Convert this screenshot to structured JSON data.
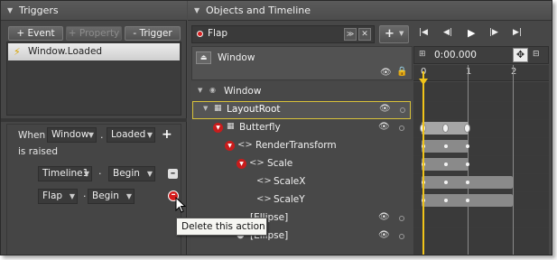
{
  "triggers": {
    "title": "Triggers",
    "buttons": {
      "event": "+ Event",
      "property": "+ Property",
      "trigger": "- Trigger"
    },
    "list_item": "Window.Loaded",
    "condition": {
      "when": "When",
      "target": "Window",
      "dot": ".",
      "event": "Loaded",
      "is_raised": "is raised"
    },
    "actions": [
      {
        "target": "Timeline1",
        "sep": "·",
        "verb": "Begin"
      },
      {
        "target": "Flap",
        "sep": "·",
        "verb": "Begin"
      }
    ],
    "tooltip": "Delete this action"
  },
  "objects": {
    "title": "Objects and Timeline",
    "storyboard_name": "Flap",
    "time_display": "0:00.000",
    "root_name": "Window",
    "tree": [
      {
        "label": "Window"
      },
      {
        "label": "LayoutRoot"
      },
      {
        "label": "Butterfly"
      },
      {
        "label": "RenderTransform"
      },
      {
        "label": "Scale"
      },
      {
        "label": "ScaleX"
      },
      {
        "label": "ScaleY"
      },
      {
        "label": "[Ellipse]"
      },
      {
        "label": "[Ellipse]"
      }
    ],
    "ruler": [
      "0",
      "1",
      "2"
    ],
    "colors": {
      "playhead": "#f0c419",
      "selection": "#d8c23a",
      "record": "#d82020"
    }
  }
}
